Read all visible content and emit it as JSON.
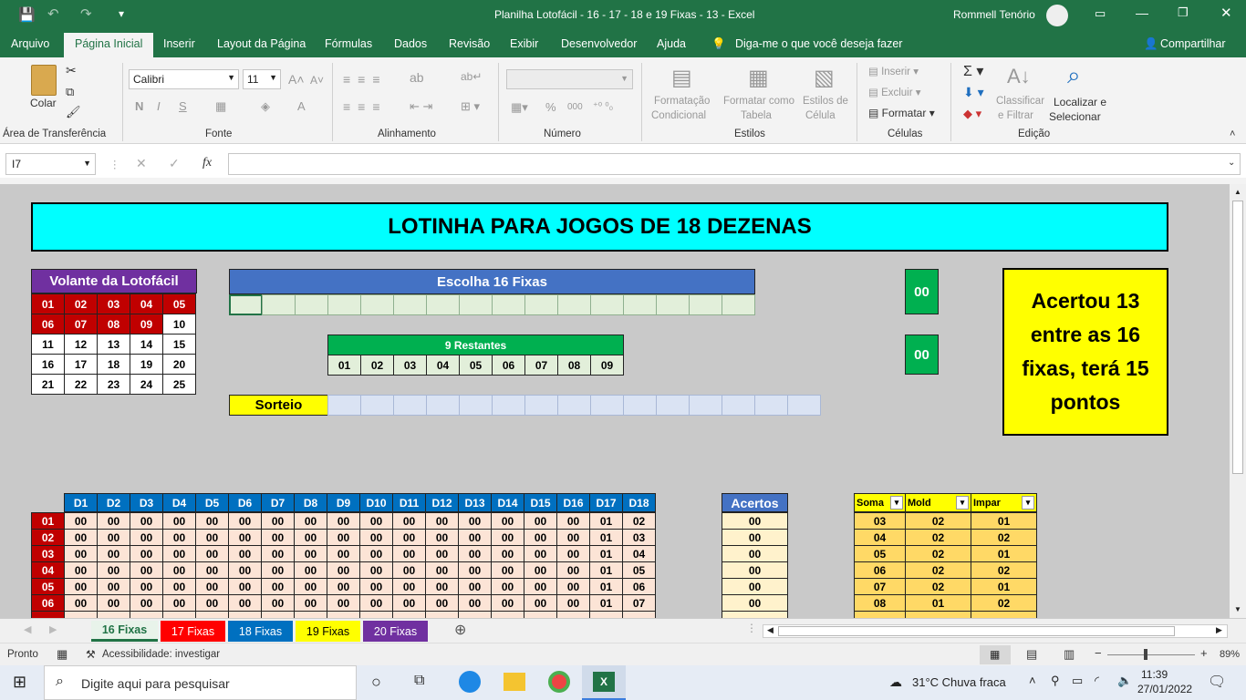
{
  "window": {
    "title": "Planilha Lotofácil - 16 - 17 - 18 e 19 Fixas - 13  -  Excel",
    "user": "Rommell Tenório"
  },
  "tabs": [
    "Arquivo",
    "Página Inicial",
    "Inserir",
    "Layout da Página",
    "Fórmulas",
    "Dados",
    "Revisão",
    "Exibir",
    "Desenvolvedor",
    "Ajuda"
  ],
  "tell_me": "Diga-me o que você deseja fazer",
  "share": "Compartilhar",
  "ribbon": {
    "groups": [
      "Área de Transferência",
      "Fonte",
      "Alinhamento",
      "Número",
      "Estilos",
      "Células",
      "Edição"
    ],
    "paste": "Colar",
    "font_name": "Calibri",
    "font_size": "11",
    "bold": "N",
    "italic": "I",
    "underline": "S",
    "cond_format_1": "Formatação",
    "cond_format_2": "Condicional",
    "format_table_1": "Formatar como",
    "format_table_2": "Tabela",
    "cell_styles_1": "Estilos de",
    "cell_styles_2": "Célula",
    "insert": "Inserir",
    "delete": "Excluir",
    "format": "Formatar",
    "sort_1": "Classificar",
    "sort_2": "e Filtrar",
    "find_1": "Localizar e",
    "find_2": "Selecionar"
  },
  "formula_bar": {
    "name_box": "I7",
    "fx": "fx",
    "formula": ""
  },
  "sheet": {
    "title": "LOTINHA PARA JOGOS DE 18 DEZENAS",
    "volante_title": "Volante da Lotofácil",
    "volante": [
      [
        "01",
        "02",
        "03",
        "04",
        "05"
      ],
      [
        "06",
        "07",
        "08",
        "09",
        "10"
      ],
      [
        "11",
        "12",
        "13",
        "14",
        "15"
      ],
      [
        "16",
        "17",
        "18",
        "19",
        "20"
      ],
      [
        "21",
        "22",
        "23",
        "24",
        "25"
      ]
    ],
    "escolha_title": "Escolha 16 Fixas",
    "restantes_title": "9 Restantes",
    "restantes": [
      "01",
      "02",
      "03",
      "04",
      "05",
      "06",
      "07",
      "08",
      "09"
    ],
    "sorteio_label": "Sorteio",
    "counter1": "00",
    "counter2": "00",
    "message": "Acertou 13 entre as 16 fixas, terá 15 pontos",
    "dheaders": [
      "D1",
      "D2",
      "D3",
      "D4",
      "D5",
      "D6",
      "D7",
      "D8",
      "D9",
      "D10",
      "D11",
      "D12",
      "D13",
      "D14",
      "D15",
      "D16",
      "D17",
      "D18"
    ],
    "rows": [
      {
        "n": "01",
        "d": [
          "00",
          "00",
          "00",
          "00",
          "00",
          "00",
          "00",
          "00",
          "00",
          "00",
          "00",
          "00",
          "00",
          "00",
          "00",
          "00",
          "01",
          "02"
        ],
        "ac": "00",
        "soma": "03",
        "mold": "02",
        "impar": "01"
      },
      {
        "n": "02",
        "d": [
          "00",
          "00",
          "00",
          "00",
          "00",
          "00",
          "00",
          "00",
          "00",
          "00",
          "00",
          "00",
          "00",
          "00",
          "00",
          "00",
          "01",
          "03"
        ],
        "ac": "00",
        "soma": "04",
        "mold": "02",
        "impar": "02"
      },
      {
        "n": "03",
        "d": [
          "00",
          "00",
          "00",
          "00",
          "00",
          "00",
          "00",
          "00",
          "00",
          "00",
          "00",
          "00",
          "00",
          "00",
          "00",
          "00",
          "01",
          "04"
        ],
        "ac": "00",
        "soma": "05",
        "mold": "02",
        "impar": "01"
      },
      {
        "n": "04",
        "d": [
          "00",
          "00",
          "00",
          "00",
          "00",
          "00",
          "00",
          "00",
          "00",
          "00",
          "00",
          "00",
          "00",
          "00",
          "00",
          "00",
          "01",
          "05"
        ],
        "ac": "00",
        "soma": "06",
        "mold": "02",
        "impar": "02"
      },
      {
        "n": "05",
        "d": [
          "00",
          "00",
          "00",
          "00",
          "00",
          "00",
          "00",
          "00",
          "00",
          "00",
          "00",
          "00",
          "00",
          "00",
          "00",
          "00",
          "01",
          "06"
        ],
        "ac": "00",
        "soma": "07",
        "mold": "02",
        "impar": "01"
      },
      {
        "n": "06",
        "d": [
          "00",
          "00",
          "00",
          "00",
          "00",
          "00",
          "00",
          "00",
          "00",
          "00",
          "00",
          "00",
          "00",
          "00",
          "00",
          "00",
          "01",
          "07"
        ],
        "ac": "00",
        "soma": "08",
        "mold": "01",
        "impar": "02"
      }
    ],
    "acertos_header": "Acertos",
    "soma_header": "Soma",
    "mold_header": "Mold",
    "impar_header": "Impar"
  },
  "sheet_tabs": [
    {
      "label": "16 Fixas",
      "bg": "#e8f3ea",
      "fg": "#217346"
    },
    {
      "label": "17 Fixas",
      "bg": "#ff0000",
      "fg": "#ffffff"
    },
    {
      "label": "18 Fixas",
      "bg": "#0070c0",
      "fg": "#ffffff"
    },
    {
      "label": "19 Fixas",
      "bg": "#ffff00",
      "fg": "#000000"
    },
    {
      "label": "20 Fixas",
      "bg": "#7030a0",
      "fg": "#ffffff"
    }
  ],
  "status": {
    "ready": "Pronto",
    "accessibility": "Acessibilidade: investigar",
    "zoom": "89%"
  },
  "taskbar": {
    "search": "Digite aqui para pesquisar",
    "weather": "31°C  Chuva fraca",
    "time": "11:39",
    "date": "27/01/2022"
  },
  "colors": {
    "excel_green": "#217346",
    "title_cyan": "#00ffff",
    "volante_purple": "#7030a0",
    "red": "#c00000",
    "blue_header": "#4472c4",
    "green": "#00b050",
    "yellow": "#ffff00",
    "gold": "#ffd966",
    "peach": "#fce4d6"
  }
}
